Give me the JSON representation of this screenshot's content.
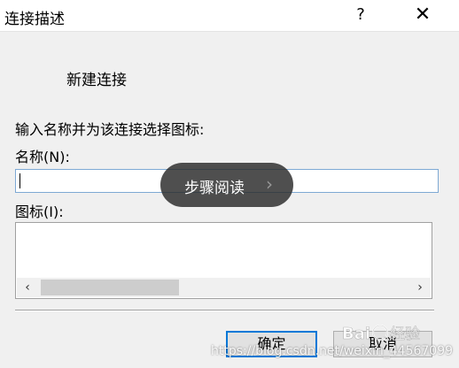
{
  "titlebar": {
    "title": "连接描述",
    "help": "?",
    "close": "✕"
  },
  "dialog": {
    "connection_name": "新建连接",
    "instruction": "输入名称并为该连接选择图标:",
    "name_label": "名称(N):",
    "name_value": "",
    "icon_label": "图标(I):",
    "scroll_left": "‹",
    "scroll_right": "›"
  },
  "buttons": {
    "ok": "确定",
    "cancel": "取消"
  },
  "overlay": {
    "text": "步骤阅读",
    "arrow": "›"
  },
  "watermark": {
    "url": "https://blog.csdn.net/weixin_44567099",
    "logo_text": "Bai经验"
  }
}
